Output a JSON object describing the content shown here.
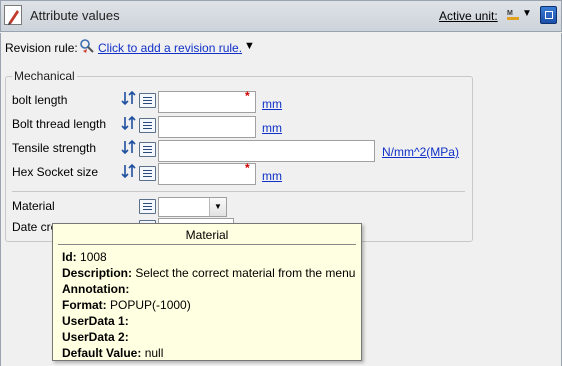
{
  "header": {
    "title": "Attribute values",
    "active_unit_label": "Active unit:",
    "icons": [
      "edit-icon",
      "unit-icon",
      "dropdown-arrow-icon",
      "maximize-icon"
    ]
  },
  "revision": {
    "label": "Revision rule:",
    "link": "Click to add a revision rule.",
    "icons": [
      "revision-rule-icon",
      "dropdown-arrow-icon"
    ]
  },
  "group": {
    "title": "Mechanical",
    "rows": [
      {
        "label": "bolt length",
        "value": "",
        "required": true,
        "unit": "mm"
      },
      {
        "label": "Bolt thread length",
        "value": "",
        "required": false,
        "unit": "mm"
      },
      {
        "label": "Tensile strength",
        "value": "",
        "required": false,
        "unit": "N/mm^2(MPa)"
      },
      {
        "label": "Hex Socket size",
        "value": "",
        "required": true,
        "unit": "mm"
      }
    ],
    "material_label": "Material",
    "material_value": "",
    "date_label": "Date cre",
    "required_mark": "*"
  },
  "tooltip": {
    "title": "Material",
    "lines": [
      {
        "key": "Id:",
        "value": "1008"
      },
      {
        "key": "Description:",
        "value": "Select the correct material from the menu"
      },
      {
        "key": "Annotation:",
        "value": ""
      },
      {
        "key": "Format:",
        "value": "POPUP(-1000)"
      },
      {
        "key": "UserData 1:",
        "value": ""
      },
      {
        "key": "UserData 2:",
        "value": ""
      },
      {
        "key": "Default Value:",
        "value": "null"
      }
    ]
  },
  "colors": {
    "link": "#1030c8",
    "required": "#d00000",
    "tooltip_bg": "#ffffe1"
  }
}
